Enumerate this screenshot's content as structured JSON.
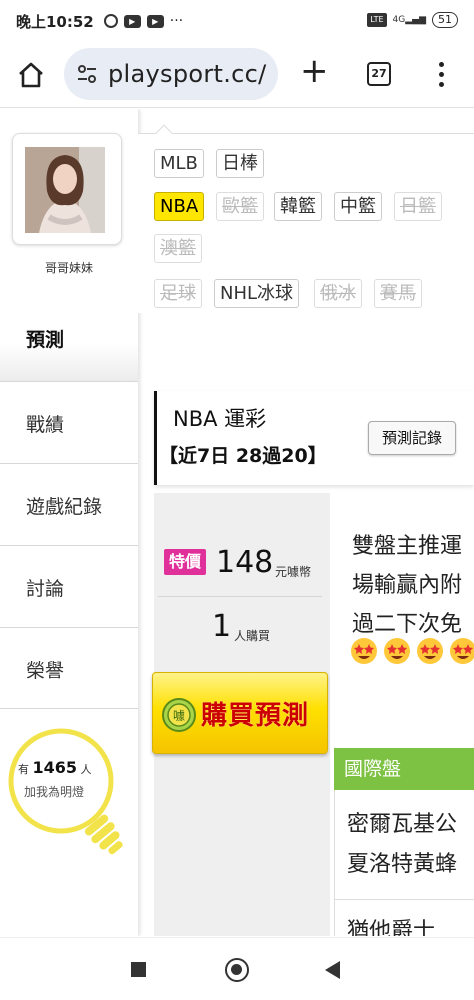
{
  "status_bar": {
    "time": "晚上10:52",
    "lte_label": "LTE",
    "signal_label": "4G",
    "battery": "51"
  },
  "browser": {
    "url": "playsport.cc/",
    "tab_count": "27"
  },
  "sidebar": {
    "user_name": "哥哥妹妹",
    "active_item": "預測",
    "items": [
      {
        "label": "戰績"
      },
      {
        "label": "遊戲紀錄"
      },
      {
        "label": "討論"
      },
      {
        "label": "榮譽"
      }
    ],
    "bulb": {
      "prefix": "有",
      "count": "1465",
      "suffix": "人",
      "caption": "加我為明燈"
    }
  },
  "filters": {
    "chips": [
      {
        "label": "MLB",
        "state": "normal"
      },
      {
        "label": "日棒",
        "state": "normal"
      },
      {
        "label": "NBA",
        "state": "selected"
      },
      {
        "label": "歐籃",
        "state": "disabled"
      },
      {
        "label": "韓籃",
        "state": "normal"
      },
      {
        "label": "中籃",
        "state": "normal"
      },
      {
        "label": "日籃",
        "state": "disabled"
      },
      {
        "label": "澳籃",
        "state": "disabled"
      },
      {
        "label": "足球",
        "state": "disabled"
      },
      {
        "label": "NHL冰球",
        "state": "normal"
      },
      {
        "label": "俄冰",
        "state": "disabled"
      },
      {
        "label": "賽馬",
        "state": "disabled"
      }
    ]
  },
  "card": {
    "title": "NBA 運彩",
    "record": "【近7日 28過20】",
    "record_button": "預測記錄",
    "badge": "特價",
    "price": "148",
    "price_unit": "元噱幣",
    "buyers": "1",
    "buyers_unit": "人購買",
    "buy_button": "購買預測",
    "coin_label": "噱",
    "description_lines": [
      "雙盤主推運",
      "場輸贏內附",
      "過二下次免"
    ],
    "emoji_count": 4,
    "intl_header": "國際盤",
    "intl_lines": [
      "密爾瓦基公",
      "夏洛特黃蜂",
      "猶他爵士"
    ]
  },
  "colors": {
    "accent_yellow": "#ffe600",
    "badge_pink": "#e0309a",
    "intl_green": "#7dc242",
    "buy_text_red": "#cc0000"
  }
}
